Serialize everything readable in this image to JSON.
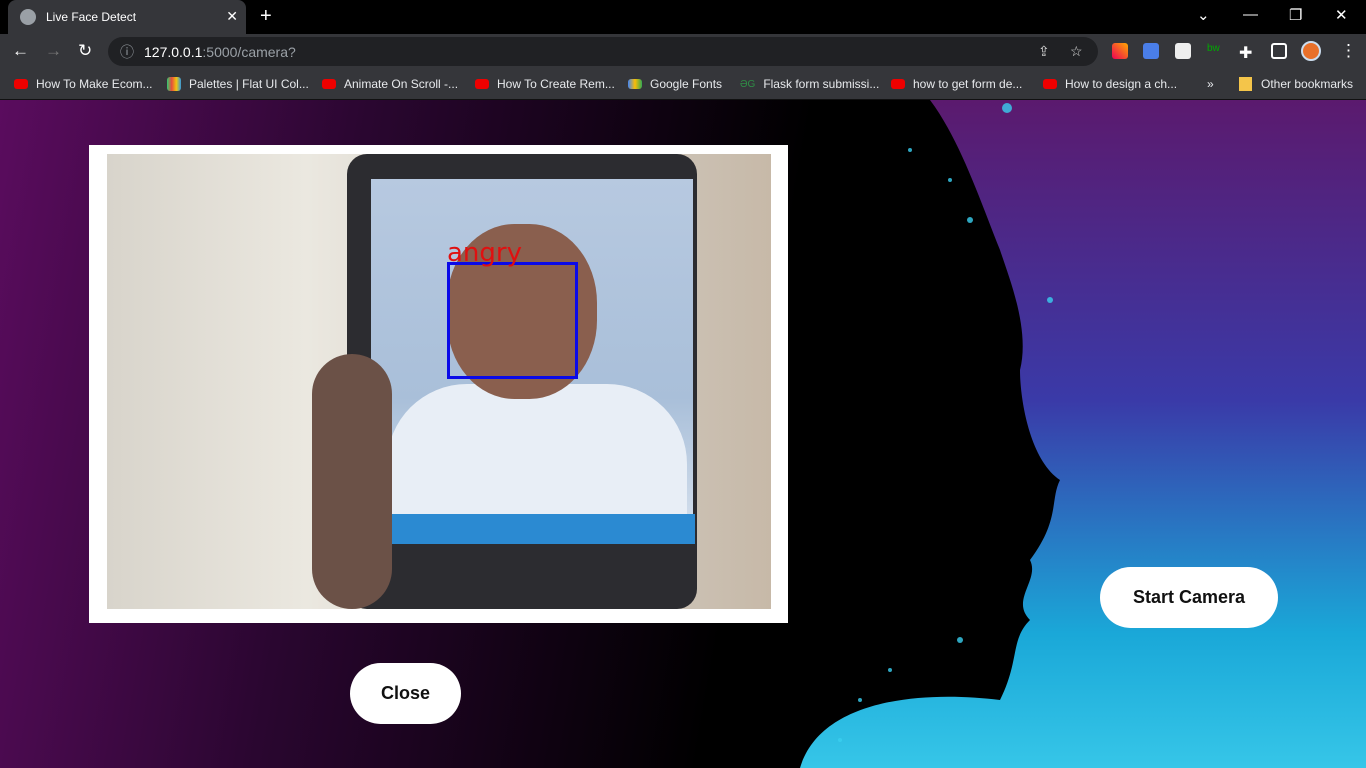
{
  "browser": {
    "tab_title": "Live Face Detect",
    "url_host": "127.0.0.1",
    "url_path": ":5000/camera?",
    "bookmarks": [
      "How To Make Ecom...",
      "Palettes | Flat UI Col...",
      "Animate On Scroll -...",
      "How To Create Rem...",
      "Google Fonts",
      "Flask form submissi...",
      "how to get form de...",
      "How to design a ch..."
    ],
    "other_bookmarks": "Other bookmarks",
    "overflow": "»"
  },
  "camera": {
    "emotion_label": "angry",
    "box_color": "#0a0ae8",
    "label_color": "#e01010"
  },
  "buttons": {
    "close": "Close",
    "start_camera": "Start Camera"
  }
}
